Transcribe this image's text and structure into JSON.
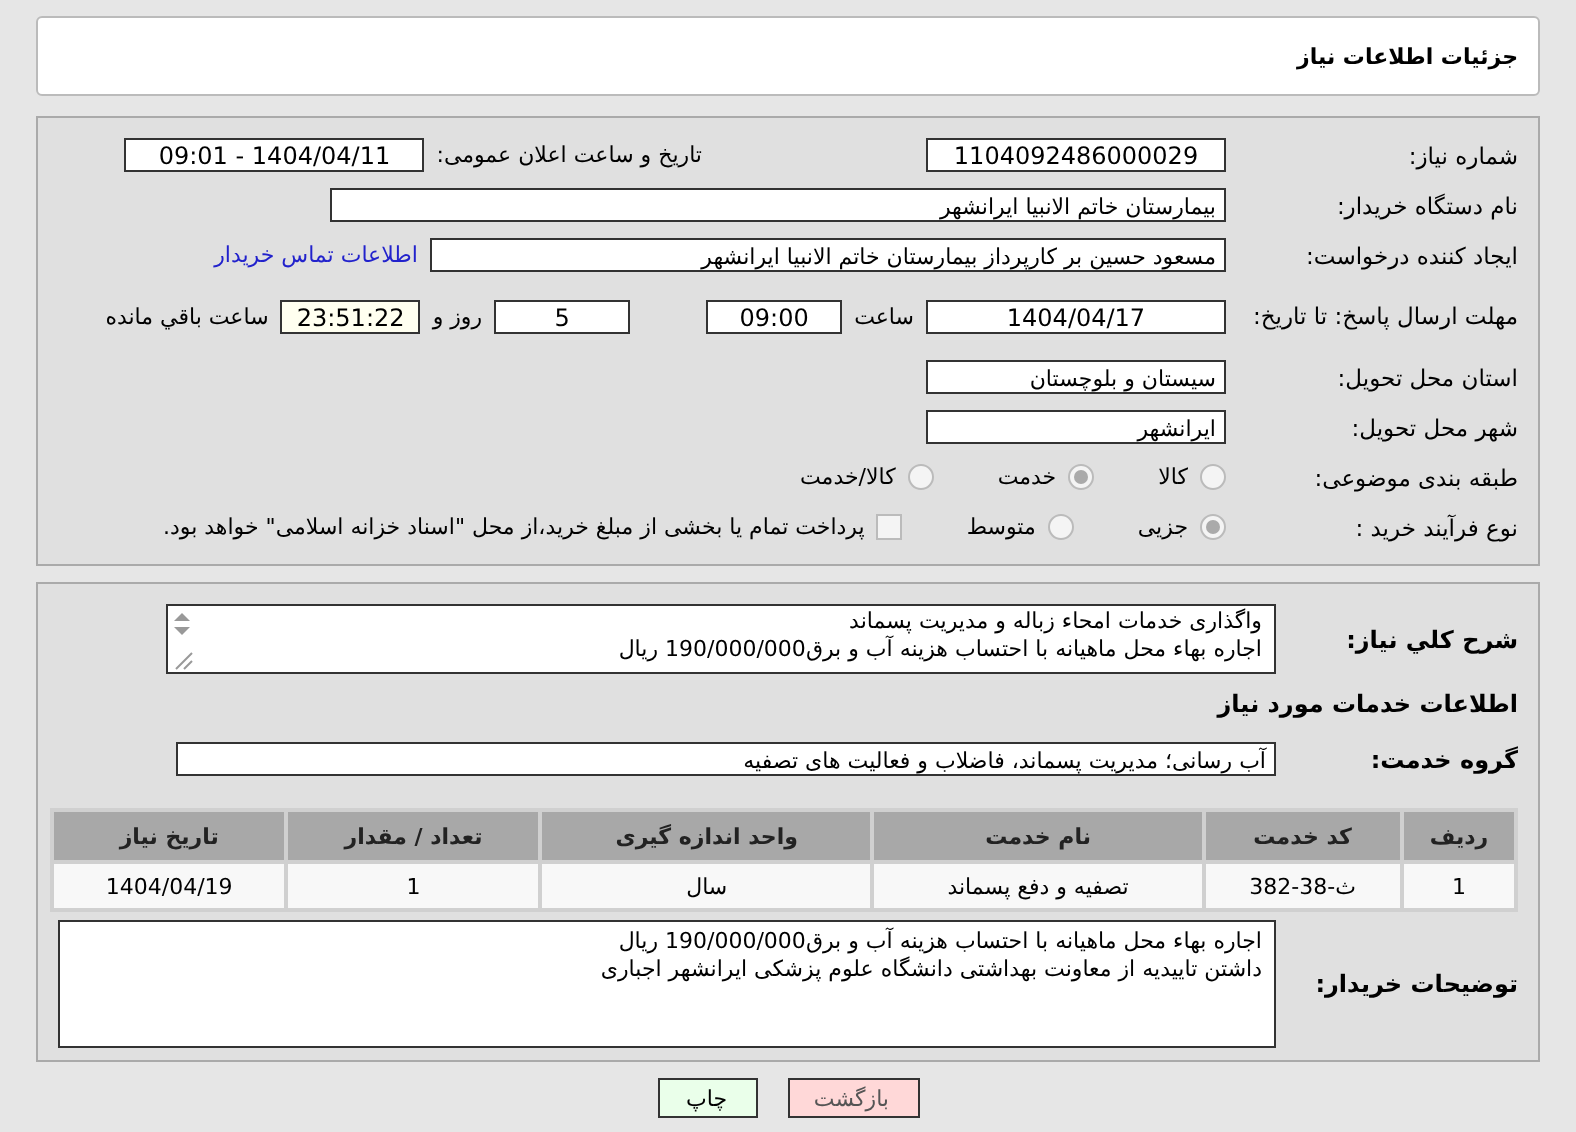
{
  "header": {
    "title": "جزئیات اطلاعات نیاز"
  },
  "details": {
    "need_number": {
      "label": "شماره نیاز:",
      "value": "1104092486000029"
    },
    "announce": {
      "label": "تاریخ و ساعت اعلان عمومی:",
      "value": "1404/04/11 - 09:01"
    },
    "buyer": {
      "label": "نام دستگاه خریدار:",
      "value": "بیمارستان خاتم الانبیا ایرانشهر"
    },
    "creator": {
      "label": "ایجاد کننده درخواست:",
      "value": "مسعود حسین بر کارپرداز بیمارستان خاتم الانبیا ایرانشهر",
      "link": "اطلاعات تماس خریدار"
    },
    "deadline": {
      "label": "مهلت ارسال پاسخ: تا تاریخ:",
      "date": "1404/04/17",
      "time_label": "ساعت",
      "time": "09:00",
      "days": "5",
      "days_label": "روز و",
      "remaining": "23:51:22",
      "remaining_label": "ساعت باقي مانده"
    },
    "province": {
      "label": "استان محل تحویل:",
      "value": "سیستان و بلوچستان"
    },
    "city": {
      "label": "شهر محل تحویل:",
      "value": "ایرانشهر"
    },
    "category": {
      "label": "طبقه بندی موضوعی:",
      "options": [
        {
          "label": "کالا",
          "selected": false
        },
        {
          "label": "خدمت",
          "selected": true
        },
        {
          "label": "کالا/خدمت",
          "selected": false
        }
      ]
    },
    "purchase_type": {
      "label": "نوع فرآیند خرید :",
      "options": [
        {
          "label": "جزیی",
          "selected": true
        },
        {
          "label": "متوسط",
          "selected": false
        }
      ],
      "payment": {
        "label": "پرداخت تمام یا بخشی از مبلغ خرید،از محل \"اسناد خزانه اسلامی\" خواهد بود.",
        "checked": false
      }
    }
  },
  "summary": {
    "label": "شرح کلي نیاز:",
    "lines": [
      "واگذاری خدمات امحاء زباله و مدیریت پسماند",
      "اجاره بهاء محل ماهیانه  با احتساب هزینه آب و برق190/000/000 ریال"
    ]
  },
  "services": {
    "heading": "اطلاعات خدمات مورد نیاز",
    "group_label": "گروه خدمت:",
    "group": "آب رسانی؛ مدیریت پسماند، فاضلاب و فعالیت های تصفیه",
    "table": {
      "columns": [
        "ردیف",
        "کد خدمت",
        "نام خدمت",
        "واحد اندازه گیری",
        "تعداد / مقدار",
        "تاریخ نیاز"
      ],
      "rows": [
        [
          "1",
          "ث-38-382",
          "تصفیه و دفع پسماند",
          "سال",
          "1",
          "1404/04/19"
        ]
      ]
    }
  },
  "buyer_notes": {
    "label": "توضیحات خریدار:",
    "lines": [
      "اجاره بهاء محل ماهیانه  با احتساب هزینه آب و برق190/000/000 ریال",
      "داشتن تاییدیه از معاونت بهداشتی دانشگاه علوم پزشکی ایرانشهر اجباری"
    ]
  },
  "buttons": [
    {
      "kind": "back",
      "label": "بازگشت"
    },
    {
      "kind": "print",
      "label": "چاپ"
    }
  ]
}
